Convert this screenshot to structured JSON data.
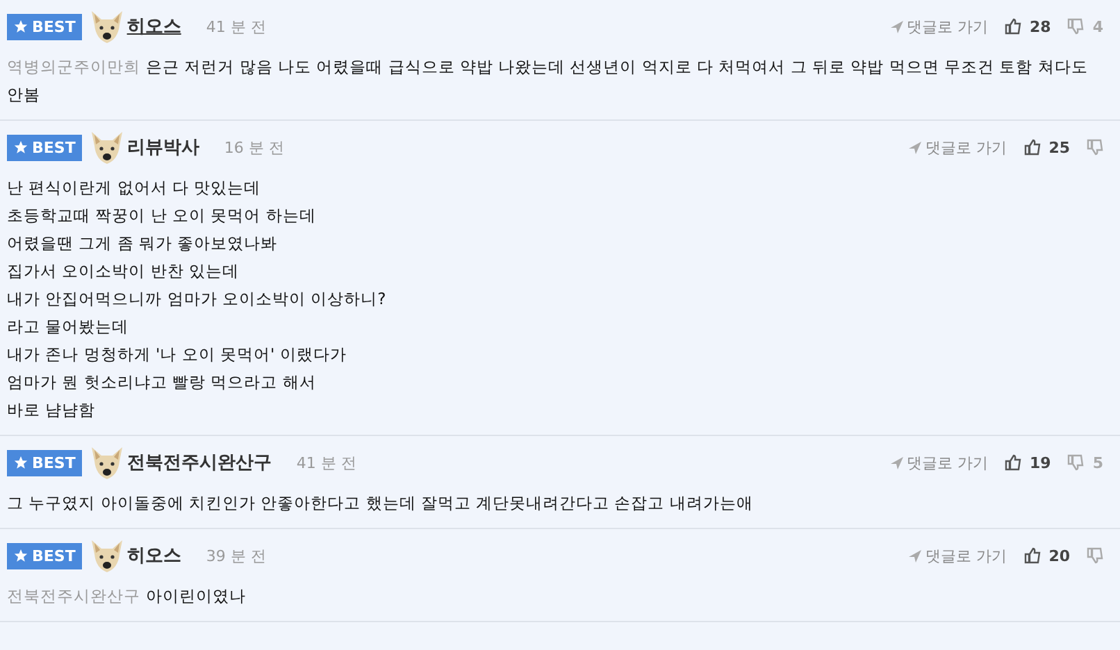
{
  "comments": [
    {
      "badge": "BEST",
      "author": "히오스",
      "hovered": true,
      "time": "41 분 전",
      "reply_link": "댓글로 가기",
      "likes": "28",
      "dislikes": "4",
      "mention": "역병의군주이만희",
      "lines": [
        "은근 저런거 많음 나도 어렸을때 급식으로 약밥 나왔는데 선생년이 억지로 다 처먹여서 그 뒤로 약밥 먹으면 무조건 토함 쳐다도 안봄"
      ]
    },
    {
      "badge": "BEST",
      "author": "리뷰박사",
      "hovered": false,
      "time": "16 분 전",
      "reply_link": "댓글로 가기",
      "likes": "25",
      "lines": [
        "난 편식이란게 없어서 다 맛있는데",
        "초등학교때 짝꿍이 난 오이 못먹어 하는데",
        "어렸을땐 그게 좀 뭐가 좋아보였나봐",
        "집가서 오이소박이 반찬 있는데",
        "내가 안집어먹으니까 엄마가 오이소박이 이상하니?",
        "라고 물어봤는데",
        "내가 존나 멍청하게 '나 오이 못먹어' 이랬다가",
        "엄마가 뭔 헛소리냐고 빨랑 먹으라고 해서",
        "바로 냠냠함"
      ]
    },
    {
      "badge": "BEST",
      "author": "전북전주시완산구",
      "hovered": false,
      "time": "41 분 전",
      "reply_link": "댓글로 가기",
      "likes": "19",
      "dislikes": "5",
      "lines": [
        "그 누구였지 아이돌중에 치킨인가 안좋아한다고 했는데 잘먹고 계단못내려간다고 손잡고 내려가는애"
      ]
    },
    {
      "badge": "BEST",
      "author": "히오스",
      "hovered": false,
      "time": "39 분 전",
      "reply_link": "댓글로 가기",
      "likes": "20",
      "mention": "전북전주시완산구",
      "lines": [
        "아이린이였나"
      ]
    }
  ]
}
